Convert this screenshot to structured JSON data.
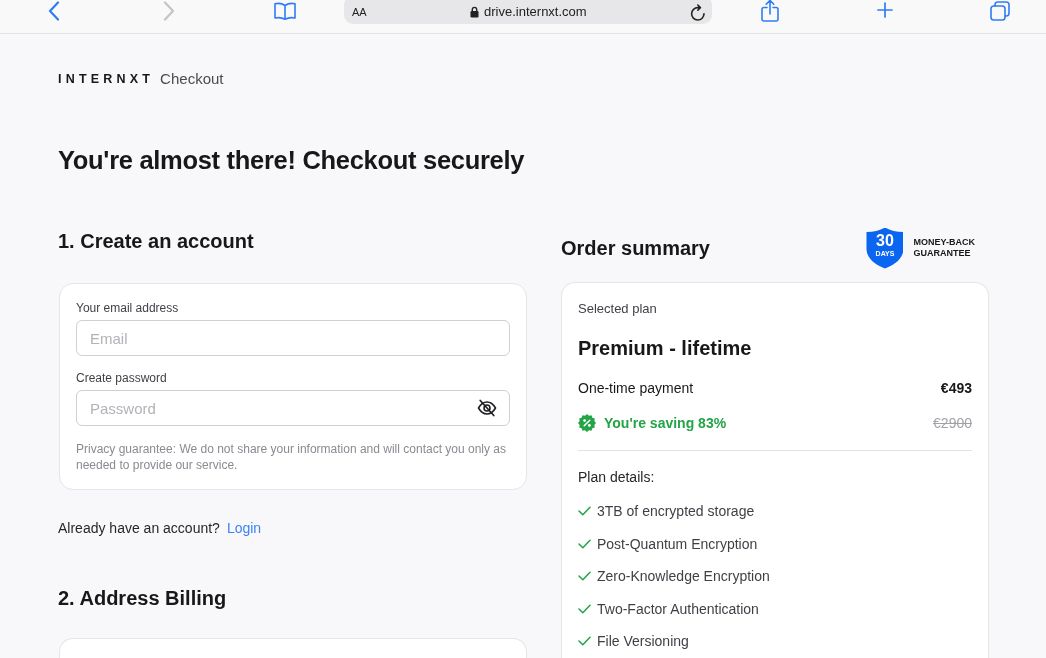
{
  "browser": {
    "back": {
      "disabled": false
    },
    "forward": {
      "disabled": true
    },
    "address": {
      "text_size": "AA",
      "url": "drive.internxt.com"
    }
  },
  "brand": {
    "logo": "INTERNXT",
    "product": "Checkout"
  },
  "heading": "You're almost there! Checkout securely",
  "account": {
    "title": "1. Create an account",
    "fields": [
      {
        "kind": "email",
        "label": "Your email address",
        "placeholder": "Email"
      },
      {
        "kind": "password",
        "label": "Create password",
        "placeholder": "Password"
      }
    ],
    "privacy_note": "Privacy guarantee: We do not share your information and will contact you only as needed to provide our service.",
    "login_prompt": "Already have an account?",
    "login_link": "Login"
  },
  "billing": {
    "title": "2. Address Billing"
  },
  "order_summary": {
    "title": "Order summary",
    "guarantee": {
      "days": "30",
      "unit": "DAYS",
      "lines": [
        "MONEY-BACK",
        "GUARANTEE"
      ]
    },
    "selected_label": "Selected plan",
    "plan_name": "Premium - lifetime",
    "payment_label": "One-time payment",
    "price": "€493",
    "saving": "You're saving 83%",
    "original_price": "€2900",
    "details_label": "Plan details:",
    "features": [
      "3TB of encrypted storage",
      "Post-Quantum Encryption",
      "Zero-Knowledge Encryption",
      "Two-Factor Authentication",
      "File Versioning"
    ]
  }
}
